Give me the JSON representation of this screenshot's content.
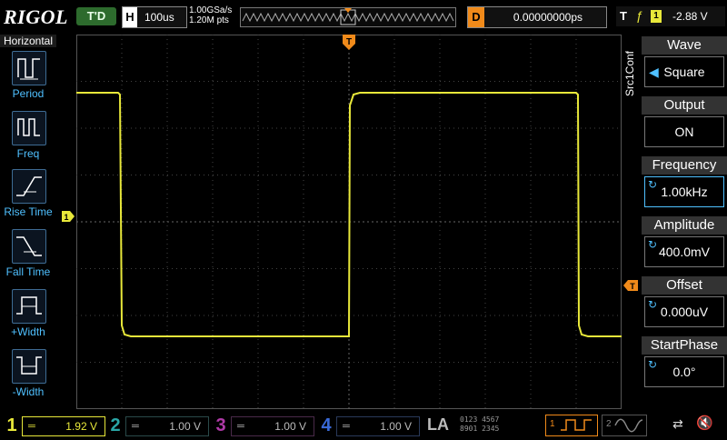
{
  "top": {
    "brand": "RIGOL",
    "trigger_status": "T'D",
    "horizontal_label": "H",
    "timebase": "100us",
    "sample_rate": "1.00GSa/s",
    "memory_depth": "1.20M pts",
    "delay_label": "D",
    "delay": "0.00000000ps",
    "trigger_label": "T",
    "trigger_source": "1",
    "trigger_level": "-2.88 V"
  },
  "left_menu": {
    "title": "Horizontal",
    "items": [
      {
        "label": "Period",
        "icon": "period-icon"
      },
      {
        "label": "Freq",
        "icon": "frequency-icon"
      },
      {
        "label": "Rise Time",
        "icon": "rise-time-icon"
      },
      {
        "label": "Fall Time",
        "icon": "fall-time-icon"
      },
      {
        "label": "+Width",
        "icon": "positive-width-icon"
      },
      {
        "label": "-Width",
        "icon": "negative-width-icon"
      }
    ]
  },
  "right_menu": {
    "side_label": "Src1Conf",
    "items": [
      {
        "label": "Wave",
        "value": "Square"
      },
      {
        "label": "Output",
        "value": "ON"
      },
      {
        "label": "Frequency",
        "value": "1.00kHz"
      },
      {
        "label": "Amplitude",
        "value": "400.0mV"
      },
      {
        "label": "Offset",
        "value": "0.000uV"
      },
      {
        "label": "StartPhase",
        "value": "0.0°"
      }
    ]
  },
  "channels": [
    {
      "num": "1",
      "coupling": "═",
      "scale": "1.92 V",
      "color": "#e8e83a",
      "active": true
    },
    {
      "num": "2",
      "coupling": "═",
      "scale": "1.00 V",
      "color": "#2aa7a7",
      "active": false
    },
    {
      "num": "3",
      "coupling": "═",
      "scale": "1.00 V",
      "color": "#b03aa8",
      "active": false
    },
    {
      "num": "4",
      "coupling": "═",
      "scale": "1.00 V",
      "color": "#3a6ad8",
      "active": false
    }
  ],
  "la": {
    "label": "LA",
    "bits_row1": "0123 4567",
    "bits_row2": "8901 2345"
  },
  "generators": [
    {
      "num": "1"
    },
    {
      "num": "2"
    }
  ],
  "colors": {
    "trace": "#e8e83a",
    "accent": "#f08a1a",
    "grid": "#505050"
  }
}
